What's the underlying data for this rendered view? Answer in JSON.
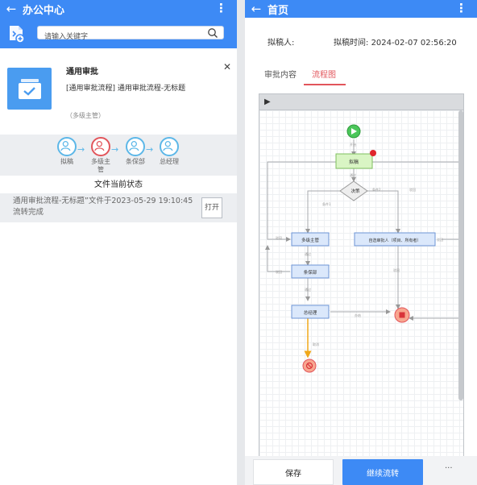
{
  "left": {
    "appbar": {
      "back_icon": "arrow-left-icon",
      "title": "办公中心",
      "more_icon": "kebab-menu-icon"
    },
    "search": {
      "placeholder": "请输入关键字",
      "doc_icon": "document-add-icon",
      "search_icon": "magnifier-icon"
    },
    "card": {
      "icon": "inbox-check-icon",
      "title": "通用审批",
      "subtitle": "[通用审批流程]  通用审批流程-无标题",
      "tag": "（多级主管）",
      "close_icon": "close-icon"
    },
    "flow_steps": [
      {
        "label": "拟稿",
        "state": "done"
      },
      {
        "label": "多级主管",
        "state": "current"
      },
      {
        "label": "条保部",
        "state": "todo"
      },
      {
        "label": "总经理",
        "state": "todo"
      }
    ],
    "state_header": "文件当前状态",
    "state_text": "通用审批流程-无标题”文件于2023-05-29 19:10:45流转完成",
    "open_button": "打开",
    "colors": {
      "brand": "#3d8af5",
      "current": "#e2555b",
      "step": "#5cb7e8"
    }
  },
  "right": {
    "appbar": {
      "back_icon": "arrow-left-icon",
      "title": "首页",
      "more_icon": "kebab-menu-icon"
    },
    "drafter_label": "拟稿人:",
    "draft_time_label": "拟稿时间:",
    "draft_time_value": "2024-02-07 02:56:20",
    "tabs": [
      {
        "label": "审批内容",
        "active": false
      },
      {
        "label": "流程图",
        "active": true
      }
    ],
    "toolbar_play_icon": "play-icon",
    "diagram": {
      "nodes": {
        "start": "start-node",
        "draft": "拟稿",
        "decision": "决策",
        "multi": "多级主管",
        "self": "自选审批人（项目、所有者）",
        "baobu": "条保部",
        "gm": "总经理",
        "end_ok": "end-node",
        "end_cancel": "cancel-node"
      },
      "edge_labels": {
        "e1": "开始",
        "e2": "通过",
        "e3": "条件1",
        "e4": "条件2",
        "e5": "驳回",
        "e6": "通过",
        "e7": "驳回",
        "e8": "通过",
        "e9": "驳回",
        "e10": "驳回",
        "e11": "取消",
        "e12": "办结",
        "e13": "驳回"
      }
    },
    "buttons": {
      "save": "保存",
      "continue": "继续流转",
      "more": "···"
    }
  }
}
